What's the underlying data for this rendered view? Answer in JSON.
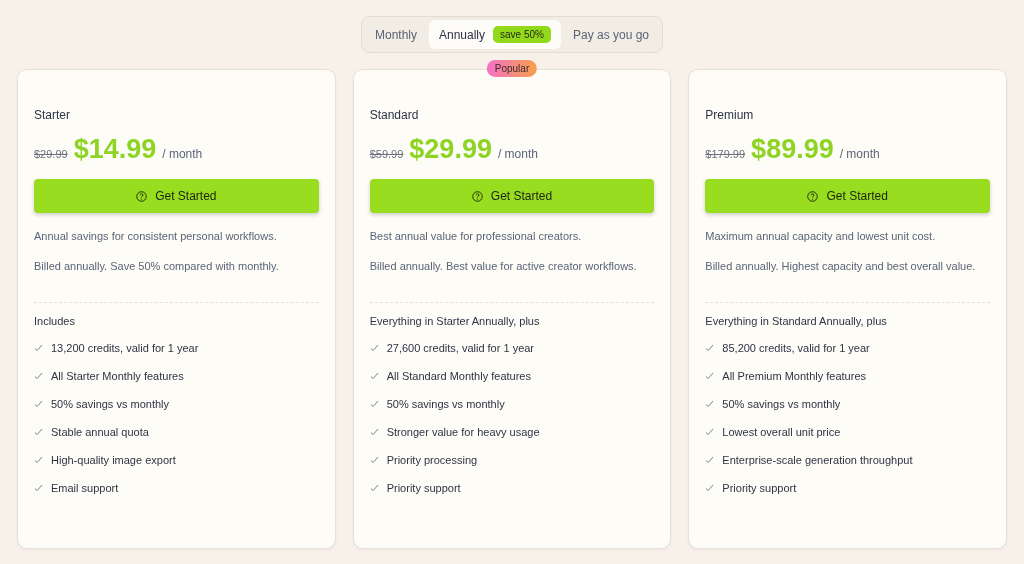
{
  "billing_tabs": [
    {
      "label": "Monthly",
      "selected": false
    },
    {
      "label": "Annually",
      "selected": true,
      "badge": "save 50%"
    },
    {
      "label": "Pay as you go",
      "selected": false
    }
  ],
  "plans": [
    {
      "name": "Starter",
      "old_price": "$29.99",
      "price": "$14.99",
      "period": "/ month",
      "button": "Get Started",
      "description": "Annual savings for consistent personal workflows.",
      "billing_note": "Billed annually. Save 50% compared with monthly.",
      "features_title": "Includes",
      "features": [
        "13,200 credits, valid for 1 year",
        "All Starter Monthly features",
        "50% savings vs monthly",
        "Stable annual quota",
        "High-quality image export",
        "Email support"
      ]
    },
    {
      "name": "Standard",
      "badge": "Popular",
      "old_price": "$59.99",
      "price": "$29.99",
      "period": "/ month",
      "button": "Get Started",
      "description": "Best annual value for professional creators.",
      "billing_note": "Billed annually. Best value for active creator workflows.",
      "features_title": "Everything in Starter Annually, plus",
      "features": [
        "27,600 credits, valid for 1 year",
        "All Standard Monthly features",
        "50% savings vs monthly",
        "Stronger value for heavy usage",
        "Priority processing",
        "Priority support"
      ]
    },
    {
      "name": "Premium",
      "old_price": "$179.99",
      "price": "$89.99",
      "period": "/ month",
      "button": "Get Started",
      "description": "Maximum annual capacity and lowest unit cost.",
      "billing_note": "Billed annually. Highest capacity and best overall value.",
      "features_title": "Everything in Standard Annually, plus",
      "features": [
        "85,200 credits, valid for 1 year",
        "All Premium Monthly features",
        "50% savings vs monthly",
        "Lowest overall unit price",
        "Enterprise-scale generation throughput",
        "Priority support"
      ]
    }
  ]
}
